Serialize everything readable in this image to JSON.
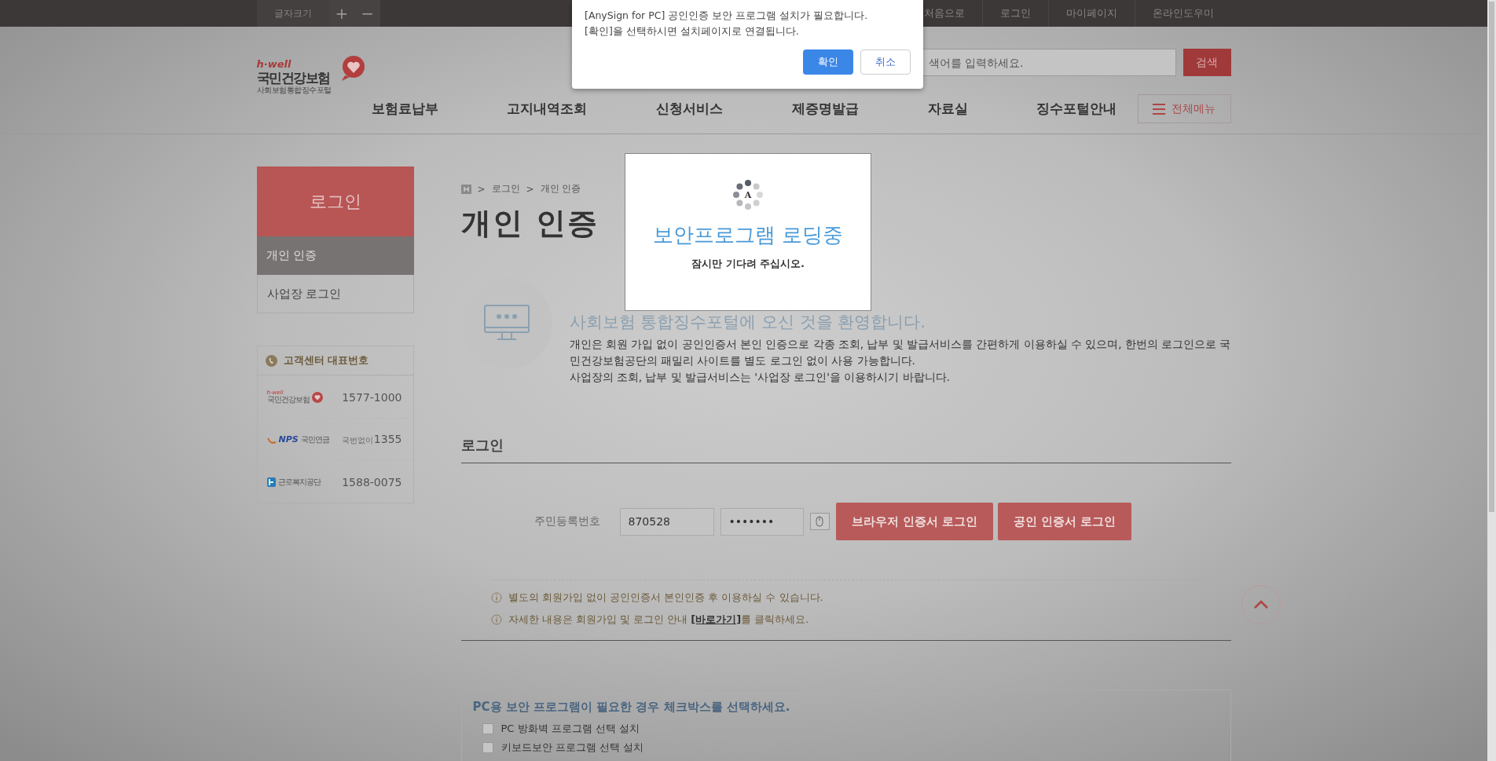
{
  "top_bar": {
    "font_size_label": "글자크기",
    "increase": "+",
    "decrease": "−",
    "links": [
      "처음으로",
      "로그인",
      "마이페이지",
      "온라인도우미"
    ]
  },
  "logo": {
    "tag": "h·well",
    "name": "국민건강보험",
    "subtitle": "사회보험통합징수포털"
  },
  "search": {
    "placeholder": "색어를 입력하세요.",
    "button": "검색"
  },
  "nav": [
    "보험료납부",
    "고지내역조회",
    "신청서비스",
    "제증명발급",
    "자료실",
    "징수포털안내"
  ],
  "menu_button": "전체메뉴",
  "sidebar": {
    "title": "로그인",
    "items": [
      {
        "label": "개인 인증",
        "selected": true
      },
      {
        "label": "사업장 로그인",
        "selected": false
      }
    ],
    "contact": {
      "title": "고객센터 대표번호",
      "rows": [
        {
          "kind": "hwell",
          "logo": [
            "h-well",
            "국민건강보험"
          ],
          "number": "1577-1000"
        },
        {
          "kind": "nps",
          "logo": [
            "NPS",
            "국민연금"
          ],
          "prefix": "국번없이",
          "number": "1355"
        },
        {
          "kind": "comwel",
          "logo": [
            "근로복지공단"
          ],
          "number": "1588-0075"
        }
      ]
    }
  },
  "breadcrumb": {
    "separator": ">",
    "items": [
      "로그인",
      "개인 인증"
    ]
  },
  "page_title": "개인 인증",
  "intro": {
    "heading": "사회보험 통합징수포털에 오신 것을 환영합니다.",
    "paragraphs": [
      "개인은 회원 가입 없이 공인인증서 본인 인증으로 각종 조회, 납부 및 발급서비스를 간편하게 이용하실 수 있으며, 한번의 로그인으로 국민건강보험공단의 패밀리 사이트를 별도 로그인 없이 사용 가능합니다.",
      "사업장의 조회, 납부 및 발급서비스는 '사업장 로그인'을 이용하시기 바랍니다."
    ]
  },
  "login": {
    "title": "로그인",
    "id_label": "주민등록번호",
    "id_front": "870528",
    "id_back": "•••••••",
    "buttons": [
      "브라우저 인증서 로그인",
      "공인 인증서 로그인"
    ]
  },
  "notes": [
    {
      "before": "별도의 회원가입 없이 공인인증서 본인인증 후 이용하실 수 있습니다."
    },
    {
      "before": "자세한 내용은 회원가입 및 로그인 안내 ",
      "link": "[바로가기]",
      "after": "를 클릭하세요."
    }
  ],
  "security": {
    "title": "PC용 보안 프로그램이 필요한 경우 체크박스를 선택하세요.",
    "options": [
      {
        "label": "PC 방화벽 프로그램 선택 설치",
        "checked": false
      },
      {
        "label": "키보드보안 프로그램 선택 설치",
        "checked": false
      }
    ]
  },
  "alert": {
    "lines": [
      "[AnySign for PC] 공인인증 보안 프로그램 설치가 필요합니다.",
      "[확인]을 선택하시면 설치페이지로 연결됩니다."
    ],
    "buttons": [
      {
        "label": "확인",
        "kind": "primary"
      },
      {
        "label": "취소",
        "kind": "secondary"
      }
    ]
  },
  "loading": {
    "badge": "A",
    "title": "보안프로그램 로딩중",
    "message": "잠시만 기다려 주십시오."
  }
}
